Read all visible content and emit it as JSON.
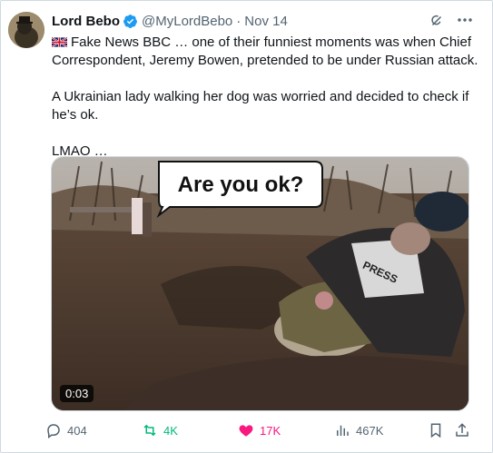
{
  "tweet": {
    "author_name": "Lord Bebo",
    "handle": "@MyLordBebo",
    "separator": "·",
    "timestamp": "Nov 14",
    "flag_icon": "uk-flag-icon",
    "paragraphs": [
      "Fake News BBC … one of their funniest moments was when Chief Correspondent, Jeremy Bowen, pretended to be under Russian attack.",
      "A Ukrainian lady walking her dog was worried and decided to check if he’s ok.",
      "LMAO …"
    ]
  },
  "media": {
    "caption_bubble": "Are you ok?",
    "vest_text": "PRESS",
    "duration": "0:03"
  },
  "actions": {
    "replies": "404",
    "reposts": "4K",
    "likes": "17K",
    "views": "467K"
  },
  "colors": {
    "text": "#0f1419",
    "muted": "#536471",
    "verified": "#1d9bf0",
    "repost": "#00ba7c",
    "like": "#f91880"
  }
}
